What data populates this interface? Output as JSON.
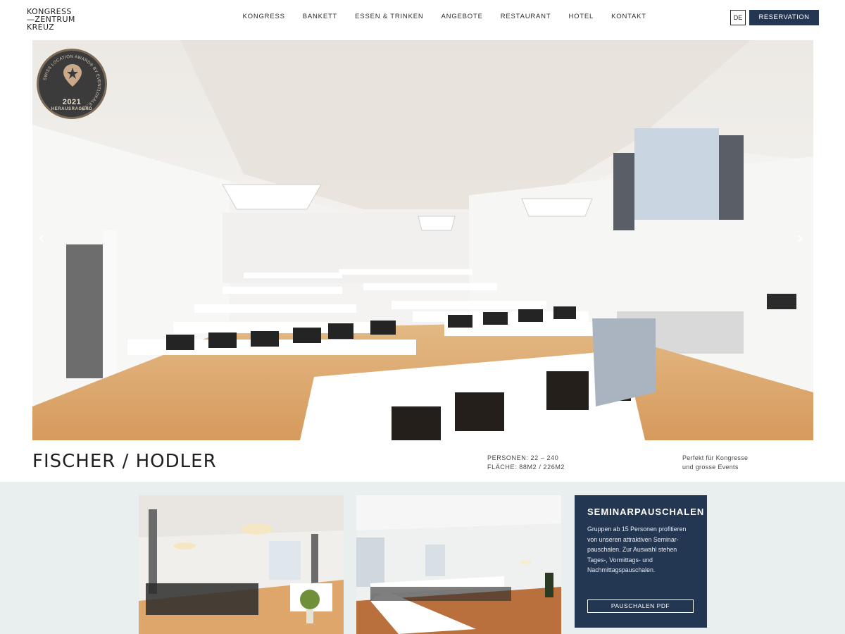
{
  "brand": {
    "logo_lines": [
      "KONGRESS",
      "—ZENTRUM",
      "KREUZ"
    ],
    "navy": "#233652"
  },
  "nav": {
    "items": [
      "KONGRESS",
      "BANKETT",
      "ESSEN & TRINKEN",
      "ANGEBOTE",
      "RESTAURANT",
      "HOTEL",
      "KONTAKT"
    ]
  },
  "header": {
    "language": "DE",
    "reservation_label": "RESERVATION"
  },
  "hero": {
    "badge": {
      "ring_text": "SWISS LOCATION AWARD® BY EVENTLOKALE.CH",
      "year": "2021",
      "label": "HERAUSRAGEND"
    },
    "prev_icon": "chevron-left-icon",
    "next_icon": "chevron-right-icon"
  },
  "room": {
    "title": "FISCHER / HODLER",
    "persons": "PERSONEN: 22 – 240",
    "area": "FLÄCHE: 88M2 / 226M2",
    "desc_line1": "Perfekt für Kongresse",
    "desc_line2": "und grosse Events"
  },
  "seminar_card": {
    "title": "SEMINARPAUSCHALEN",
    "text": "Gruppen ab 15 Personen profitieren von unseren attraktiven Seminar-pauschalen. Zur Auswahl stehen Tages-, Vormittags- und Nachmittagspauschalen.",
    "button_label": "PAUSCHALEN PDF"
  }
}
